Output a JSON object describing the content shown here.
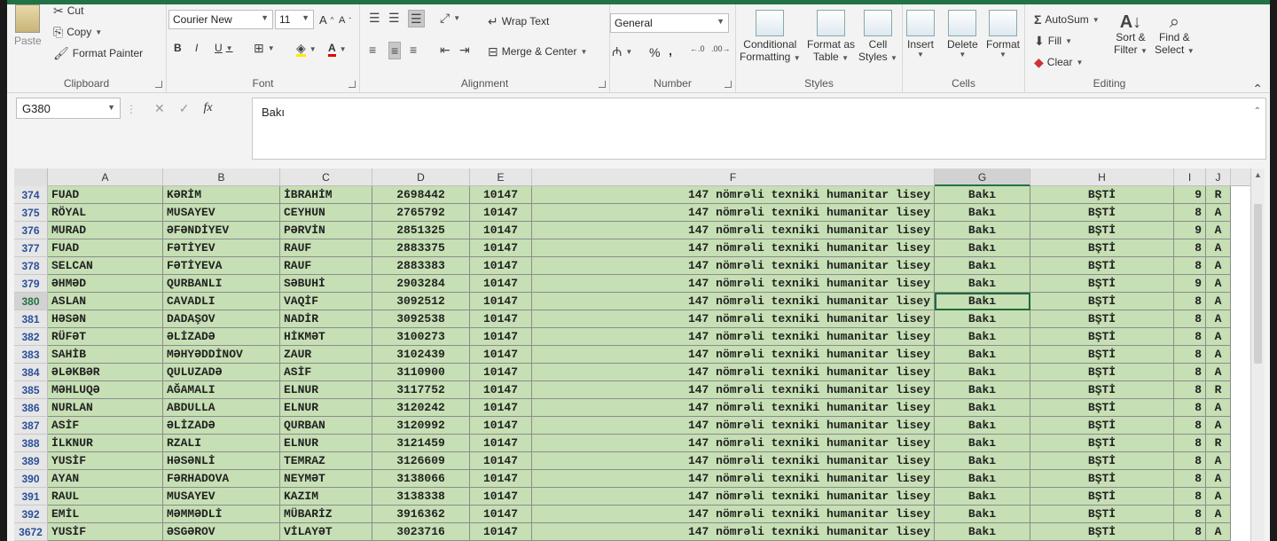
{
  "clipboard": {
    "paste": "Paste",
    "cut": "Cut",
    "copy": "Copy",
    "format_painter": "Format Painter",
    "label": "Clipboard"
  },
  "font": {
    "name": "Courier New",
    "size": "11",
    "grow": "A",
    "shrink": "A",
    "bold": "B",
    "italic": "I",
    "underline": "U",
    "font_color": "A",
    "label": "Font"
  },
  "alignment": {
    "wrap_text": "Wrap Text",
    "merge_center": "Merge & Center",
    "label": "Alignment"
  },
  "number": {
    "format": "General",
    "percent": "%",
    "comma": ",",
    "label": "Number"
  },
  "styles": {
    "conditional_1": "Conditional",
    "conditional_2": "Formatting",
    "format_table_1": "Format as",
    "format_table_2": "Table",
    "cell_styles_1": "Cell",
    "cell_styles_2": "Styles",
    "label": "Styles"
  },
  "cells": {
    "insert": "Insert",
    "delete": "Delete",
    "format": "Format",
    "label": "Cells"
  },
  "editing": {
    "autosum": "AutoSum",
    "fill": "Fill",
    "clear": "Clear",
    "sort_1": "Sort &",
    "sort_2": "Filter",
    "find_1": "Find &",
    "find_2": "Select",
    "label": "Editing"
  },
  "formula_bar": {
    "name_box": "G380",
    "fx": "fx",
    "value": "Bakı"
  },
  "colors": {
    "excel_green": "#217346",
    "cell_fill": "#c6dfb4",
    "row_number": "#2a4f9a"
  },
  "columns": [
    "A",
    "B",
    "C",
    "D",
    "E",
    "F",
    "G",
    "H",
    "I",
    "J"
  ],
  "rows": [
    {
      "num": "374",
      "A": "FUAD",
      "B": "KƏRİM",
      "C": "İBRAHİM",
      "D": "2698442",
      "E": "10147",
      "F": "147 nömrəli texniki humanitar lisey",
      "G": "Bakı",
      "H": "BŞTİ",
      "I": "9",
      "J": "R"
    },
    {
      "num": "375",
      "A": "RÖYAL",
      "B": "MUSAYEV",
      "C": "CEYHUN",
      "D": "2765792",
      "E": "10147",
      "F": "147 nömrəli texniki humanitar lisey",
      "G": "Bakı",
      "H": "BŞTİ",
      "I": "8",
      "J": "A"
    },
    {
      "num": "376",
      "A": "MURAD",
      "B": "ƏFƏNDİYEV",
      "C": "PƏRVİN",
      "D": "2851325",
      "E": "10147",
      "F": "147 nömrəli texniki humanitar lisey",
      "G": "Bakı",
      "H": "BŞTİ",
      "I": "9",
      "J": "A"
    },
    {
      "num": "377",
      "A": "FUAD",
      "B": "FƏTİYEV",
      "C": "RAUF",
      "D": "2883375",
      "E": "10147",
      "F": "147 nömrəli texniki humanitar lisey",
      "G": "Bakı",
      "H": "BŞTİ",
      "I": "8",
      "J": "A"
    },
    {
      "num": "378",
      "A": "SELCAN",
      "B": "FƏTİYEVA",
      "C": "RAUF",
      "D": "2883383",
      "E": "10147",
      "F": "147 nömrəli texniki humanitar lisey",
      "G": "Bakı",
      "H": "BŞTİ",
      "I": "8",
      "J": "A"
    },
    {
      "num": "379",
      "A": "ƏHMƏD",
      "B": "QURBANLI",
      "C": "SƏBUHİ",
      "D": "2903284",
      "E": "10147",
      "F": "147 nömrəli texniki humanitar lisey",
      "G": "Bakı",
      "H": "BŞTİ",
      "I": "9",
      "J": "A"
    },
    {
      "num": "380",
      "A": "ASLAN",
      "B": "CAVADLI",
      "C": "VAQİF",
      "D": "3092512",
      "E": "10147",
      "F": "147 nömrəli texniki humanitar lisey",
      "G": "Bakı",
      "H": "BŞTİ",
      "I": "8",
      "J": "A"
    },
    {
      "num": "381",
      "A": "HƏSƏN",
      "B": "DADAŞOV",
      "C": "NADİR",
      "D": "3092538",
      "E": "10147",
      "F": "147 nömrəli texniki humanitar lisey",
      "G": "Bakı",
      "H": "BŞTİ",
      "I": "8",
      "J": "A"
    },
    {
      "num": "382",
      "A": "RÜFƏT",
      "B": "ƏLİZADƏ",
      "C": "HİKMƏT",
      "D": "3100273",
      "E": "10147",
      "F": "147 nömrəli texniki humanitar lisey",
      "G": "Bakı",
      "H": "BŞTİ",
      "I": "8",
      "J": "A"
    },
    {
      "num": "383",
      "A": "SAHİB",
      "B": "MƏHYƏDDİNOV",
      "C": "ZAUR",
      "D": "3102439",
      "E": "10147",
      "F": "147 nömrəli texniki humanitar lisey",
      "G": "Bakı",
      "H": "BŞTİ",
      "I": "8",
      "J": "A"
    },
    {
      "num": "384",
      "A": "ƏLƏKBƏR",
      "B": "QULUZADƏ",
      "C": "ASİF",
      "D": "3110900",
      "E": "10147",
      "F": "147 nömrəli texniki humanitar lisey",
      "G": "Bakı",
      "H": "BŞTİ",
      "I": "8",
      "J": "A"
    },
    {
      "num": "385",
      "A": "MƏHLUQƏ",
      "B": "AĞAMALI",
      "C": "ELNUR",
      "D": "3117752",
      "E": "10147",
      "F": "147 nömrəli texniki humanitar lisey",
      "G": "Bakı",
      "H": "BŞTİ",
      "I": "8",
      "J": "R"
    },
    {
      "num": "386",
      "A": "NURLAN",
      "B": "ABDULLA",
      "C": "ELNUR",
      "D": "3120242",
      "E": "10147",
      "F": "147 nömrəli texniki humanitar lisey",
      "G": "Bakı",
      "H": "BŞTİ",
      "I": "8",
      "J": "A"
    },
    {
      "num": "387",
      "A": "ASİF",
      "B": "ƏLİZADƏ",
      "C": "QURBAN",
      "D": "3120992",
      "E": "10147",
      "F": "147 nömrəli texniki humanitar lisey",
      "G": "Bakı",
      "H": "BŞTİ",
      "I": "8",
      "J": "A"
    },
    {
      "num": "388",
      "A": "İLKNUR",
      "B": "RZALI",
      "C": "ELNUR",
      "D": "3121459",
      "E": "10147",
      "F": "147 nömrəli texniki humanitar lisey",
      "G": "Bakı",
      "H": "BŞTİ",
      "I": "8",
      "J": "R"
    },
    {
      "num": "389",
      "A": "YUSİF",
      "B": "HƏSƏNLİ",
      "C": "TEMRAZ",
      "D": "3126609",
      "E": "10147",
      "F": "147 nömrəli texniki humanitar lisey",
      "G": "Bakı",
      "H": "BŞTİ",
      "I": "8",
      "J": "A"
    },
    {
      "num": "390",
      "A": "AYAN",
      "B": "FƏRHADOVA",
      "C": "NEYMƏT",
      "D": "3138066",
      "E": "10147",
      "F": "147 nömrəli texniki humanitar lisey",
      "G": "Bakı",
      "H": "BŞTİ",
      "I": "8",
      "J": "A"
    },
    {
      "num": "391",
      "A": "RAUL",
      "B": "MUSAYEV",
      "C": "KAZIM",
      "D": "3138338",
      "E": "10147",
      "F": "147 nömrəli texniki humanitar lisey",
      "G": "Bakı",
      "H": "BŞTİ",
      "I": "8",
      "J": "A"
    },
    {
      "num": "392",
      "A": "EMİL",
      "B": "MƏMMƏDLİ",
      "C": "MÜBARİZ",
      "D": "3916362",
      "E": "10147",
      "F": "147 nömrəli texniki humanitar lisey",
      "G": "Bakı",
      "H": "BŞTİ",
      "I": "8",
      "J": "A"
    },
    {
      "num": "3672",
      "A": "YUSİF",
      "B": "ƏSGƏROV",
      "C": "VİLAYƏT",
      "D": "3023716",
      "E": "10147",
      "F": "147 nömrəli texniki humanitar lisey",
      "G": "Bakı",
      "H": "BŞTİ",
      "I": "8",
      "J": "A"
    }
  ],
  "active_cell": {
    "row": "380",
    "col": "G"
  }
}
